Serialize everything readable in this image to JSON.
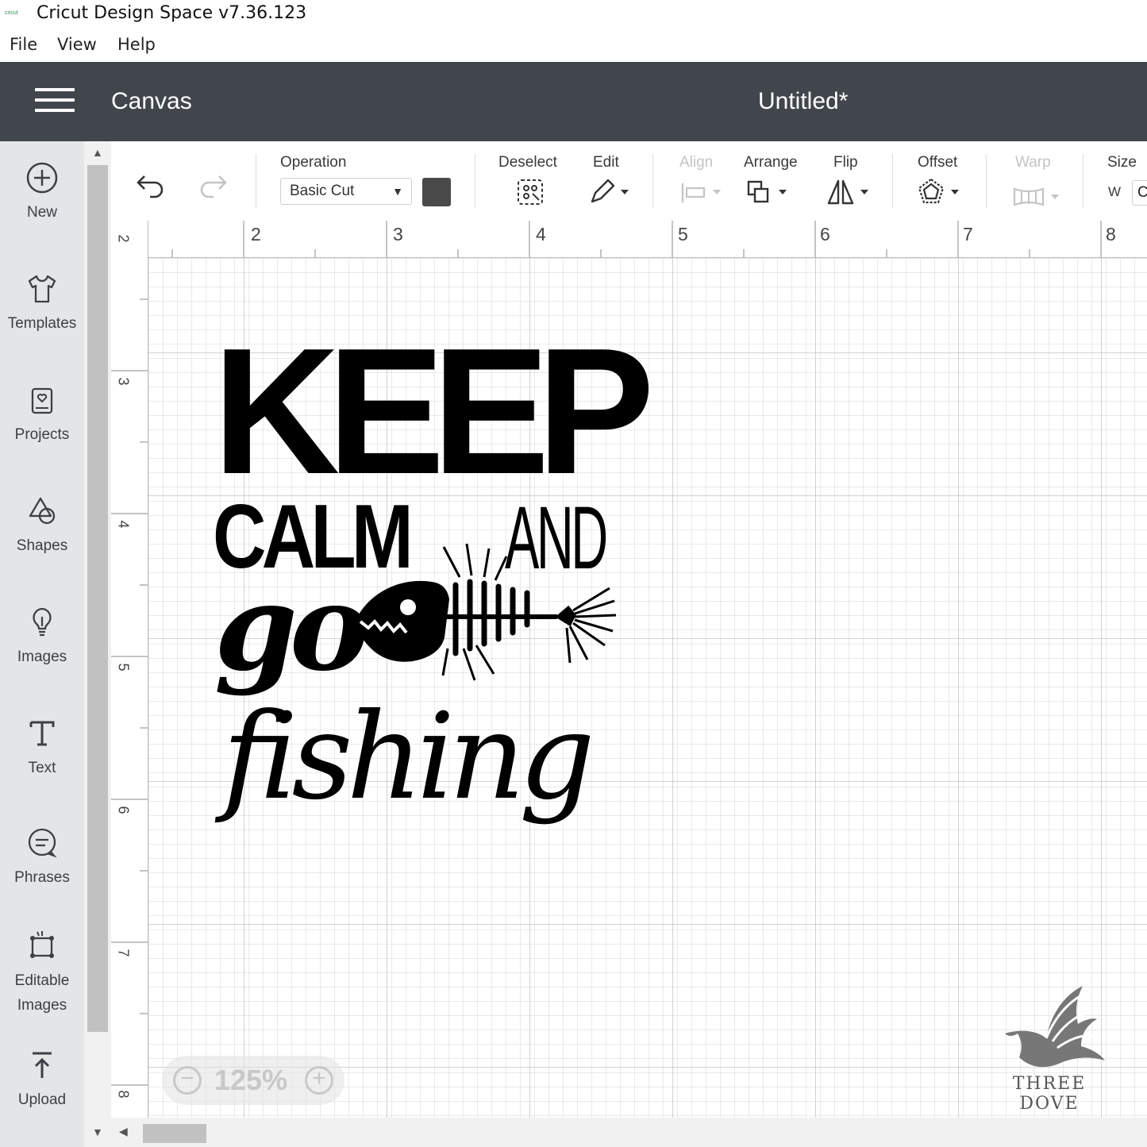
{
  "window": {
    "app_title": "Cricut Design Space  v7.36.123",
    "logo_text": "cricut"
  },
  "menu": {
    "items": [
      "File",
      "View",
      "Help"
    ]
  },
  "header": {
    "section": "Canvas",
    "document_title": "Untitled*"
  },
  "sidebar": {
    "items": [
      {
        "label": "New",
        "icon": "plus-circle-icon"
      },
      {
        "label": "Templates",
        "icon": "tshirt-icon"
      },
      {
        "label": "Projects",
        "icon": "project-icon"
      },
      {
        "label": "Shapes",
        "icon": "shapes-icon"
      },
      {
        "label": "Images",
        "icon": "lightbulb-icon"
      },
      {
        "label": "Text",
        "icon": "text-icon"
      },
      {
        "label": "Phrases",
        "icon": "speech-bubble-icon"
      },
      {
        "label": "Editable\nImages",
        "icon": "editable-images-icon"
      },
      {
        "label": "Upload",
        "icon": "upload-icon"
      }
    ]
  },
  "toolbar": {
    "operation_label": "Operation",
    "operation_value": "Basic Cut",
    "color": "#4a4a4a",
    "deselect_label": "Deselect",
    "edit_label": "Edit",
    "align_label": "Align",
    "arrange_label": "Arrange",
    "flip_label": "Flip",
    "offset_label": "Offset",
    "warp_label": "Warp",
    "size_label": "Size",
    "size_w_prefix": "W",
    "size_w_value": "C"
  },
  "canvas": {
    "h_ruler": [
      "2",
      "3",
      "4",
      "5",
      "6",
      "7",
      "8"
    ],
    "v_ruler": [
      "2",
      "3",
      "4",
      "5",
      "6",
      "7",
      "8"
    ],
    "design_text": [
      "KEEP",
      "CALM",
      "AND",
      "go",
      "fishing"
    ],
    "zoom_level": "125%"
  },
  "watermark": {
    "text": "THREE DOVE"
  }
}
